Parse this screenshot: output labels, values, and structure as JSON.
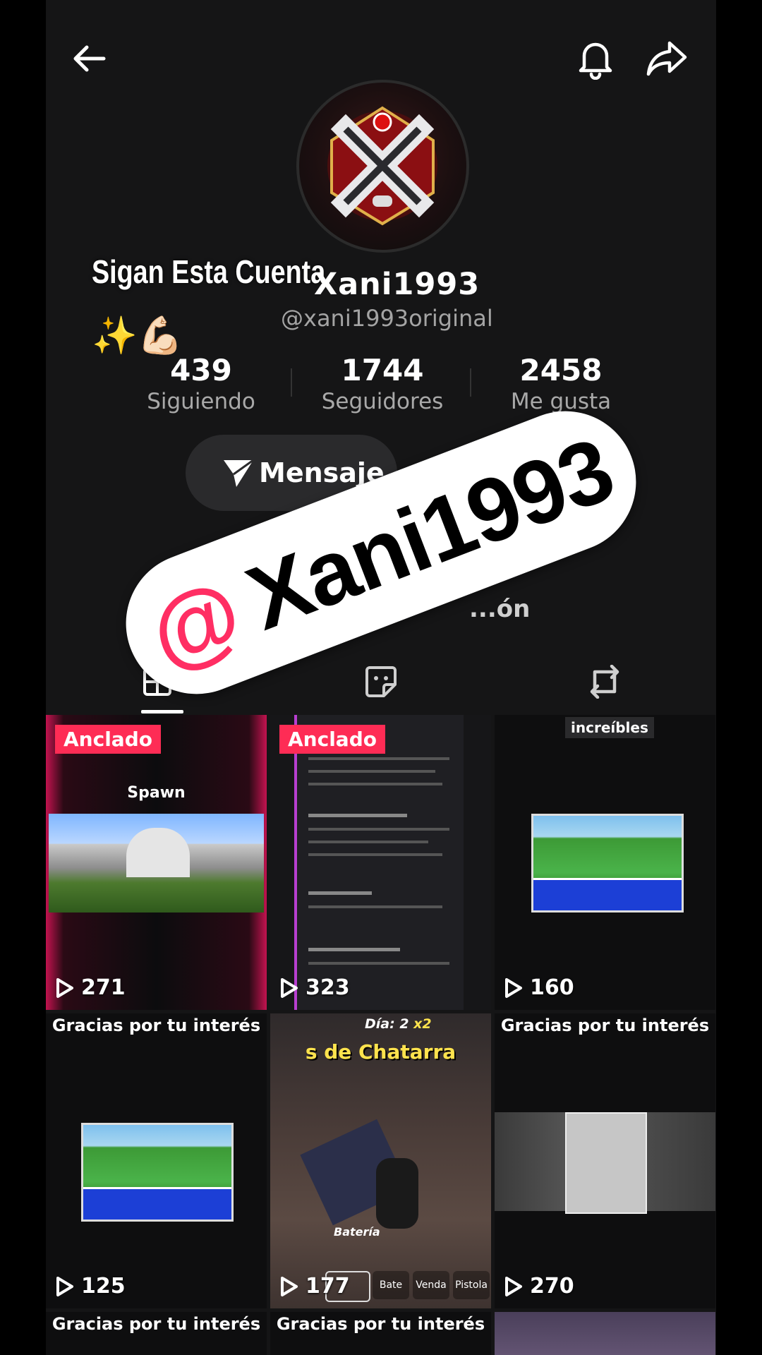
{
  "header": {
    "back_icon": "arrow-left-icon",
    "bell_icon": "bell-icon",
    "share_icon": "share-arrow-icon"
  },
  "overlay": {
    "text": "Sigan Esta Cuenta",
    "emoji": "✨💪🏻"
  },
  "profile": {
    "display_name": "Xani1993",
    "handle": "@xani1993original"
  },
  "stats": [
    {
      "value": "439",
      "label": "Siguiendo"
    },
    {
      "value": "1744",
      "label": "Seguidores"
    },
    {
      "value": "2458",
      "label": "Me gusta"
    }
  ],
  "actions": {
    "message_label": "Mensaje",
    "partial_label": "...ón"
  },
  "banner": {
    "at": "@",
    "name": "Xani1993",
    "accent": "#ff2e63"
  },
  "tabs": [
    {
      "name": "tab-videos",
      "icon": "grid-icon"
    },
    {
      "name": "tab-stickers",
      "icon": "sticker-icon"
    },
    {
      "name": "tab-reposts",
      "icon": "repost-icon"
    }
  ],
  "videos": [
    {
      "pinned": "Anclado",
      "views": "271",
      "caption": "Spawn"
    },
    {
      "pinned": "Anclado",
      "views": "323",
      "caption": ""
    },
    {
      "pinned": "",
      "views": "160",
      "caption": "increíbles"
    },
    {
      "pinned": "",
      "views": "125",
      "caption": "Gracias por tu interés"
    },
    {
      "pinned": "",
      "views": "177",
      "caption": "s de Chatarra"
    },
    {
      "pinned": "",
      "views": "270",
      "caption": "Gracias por tu interés"
    },
    {
      "pinned": "",
      "views": "",
      "caption": "Gracias por tu interés"
    },
    {
      "pinned": "",
      "views": "",
      "caption": "Gracias por tu interés"
    },
    {
      "pinned": "",
      "views": "",
      "caption": ""
    }
  ],
  "game_hud": {
    "dia": "Día: 2",
    "mult": "x2",
    "bateria": "Batería",
    "slots": [
      "Bate",
      "Venda",
      "Pistola"
    ]
  }
}
